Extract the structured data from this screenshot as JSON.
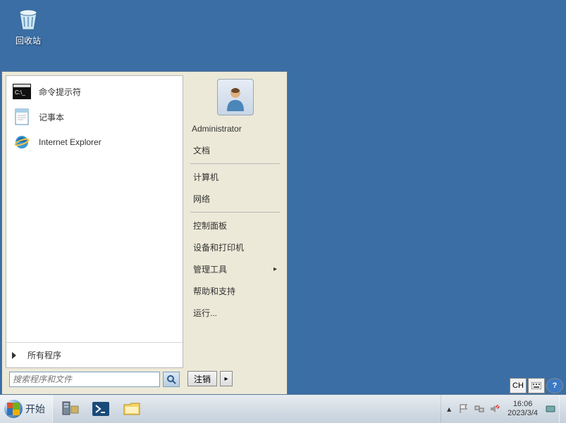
{
  "desktop": {
    "icons": [
      {
        "name": "recycle-bin",
        "label": "回收站"
      }
    ]
  },
  "start_menu": {
    "programs": [
      {
        "name": "cmd",
        "label": "命令提示符"
      },
      {
        "name": "notepad",
        "label": "记事本"
      },
      {
        "name": "ie",
        "label": "Internet Explorer"
      }
    ],
    "all_programs_label": "所有程序",
    "search_placeholder": "搜索程序和文件",
    "user": "Administrator",
    "right_items": [
      {
        "label": "文档",
        "name": "documents"
      },
      {
        "sep": true
      },
      {
        "label": "计算机",
        "name": "computer"
      },
      {
        "label": "网络",
        "name": "network"
      },
      {
        "sep": true
      },
      {
        "label": "控制面板",
        "name": "control-panel"
      },
      {
        "label": "设备和打印机",
        "name": "devices-printers"
      },
      {
        "label": "管理工具",
        "name": "admin-tools",
        "submenu": true
      },
      {
        "label": "帮助和支持",
        "name": "help"
      },
      {
        "label": "运行...",
        "name": "run"
      }
    ],
    "logoff_label": "注销"
  },
  "taskbar": {
    "start_label": "开始",
    "pinned": [
      {
        "name": "server-manager"
      },
      {
        "name": "powershell"
      },
      {
        "name": "explorer"
      }
    ],
    "tray": {
      "time": "16:06",
      "date": "2023/3/4"
    }
  },
  "lang": {
    "ime": "CH"
  }
}
